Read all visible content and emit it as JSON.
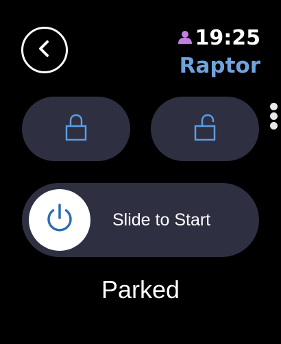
{
  "header": {
    "back_icon": "chevron-left-icon",
    "profile_icon": "person-icon",
    "time": "19:25",
    "vehicle_name": "Raptor"
  },
  "controls": {
    "lock_icon": "lock-icon",
    "unlock_icon": "unlock-icon",
    "page_count": 3
  },
  "remote_start": {
    "knob_icon": "power-icon",
    "label": "Slide to Start"
  },
  "status": {
    "text": "Parked"
  },
  "colors": {
    "background": "#000000",
    "pill": "#2e2f41",
    "accent_blue": "#6fa3dd",
    "icon_blue": "#5a9ee6",
    "power_blue": "#2f6db3",
    "profile_purple": "#c17fe0"
  }
}
